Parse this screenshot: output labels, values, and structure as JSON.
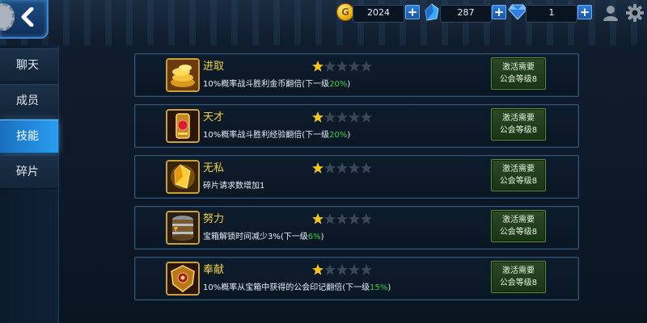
{
  "resources": {
    "gold": "2024",
    "crystal": "287",
    "diamond": "1",
    "plus_label": "+"
  },
  "sidebar": {
    "tabs": [
      {
        "label": "聊天"
      },
      {
        "label": "成员"
      },
      {
        "label": "技能"
      },
      {
        "label": "碎片"
      }
    ],
    "active_index": 2
  },
  "skills": [
    {
      "name": "进取",
      "desc_prefix": "10%概率战斗胜利金币翻倍(下一级",
      "desc_highlight": "20%",
      "desc_suffix": ")",
      "stars": 1,
      "max_stars": 5,
      "button_line1": "激活需要",
      "button_line2": "公会等级8",
      "icon": "gold-coins-icon"
    },
    {
      "name": "天才",
      "desc_prefix": "10%概率战斗胜利经验翻倍(下一级",
      "desc_highlight": "20%",
      "desc_suffix": ")",
      "stars": 1,
      "max_stars": 5,
      "button_line1": "激活需要",
      "button_line2": "公会等级8",
      "icon": "ruby-amulet-icon"
    },
    {
      "name": "无私",
      "desc_prefix": "碎片请求数增加1",
      "desc_highlight": "",
      "desc_suffix": "",
      "stars": 1,
      "max_stars": 5,
      "button_line1": "激活需要",
      "button_line2": "公会等级8",
      "icon": "golden-shard-icon"
    },
    {
      "name": "努力",
      "desc_prefix": "宝箱解锁时间减少3%(下一级",
      "desc_highlight": "6%",
      "desc_suffix": ")",
      "stars": 1,
      "max_stars": 5,
      "button_line1": "激活需要",
      "button_line2": "公会等级8",
      "icon": "barrel-icon"
    },
    {
      "name": "奉献",
      "desc_prefix": "10%概率从宝箱中获得的公会印记翻倍(下一级",
      "desc_highlight": "15%",
      "desc_suffix": ")",
      "stars": 1,
      "max_stars": 5,
      "button_line1": "激活需要",
      "button_line2": "公会等级8",
      "icon": "guild-emblem-icon"
    }
  ],
  "colors": {
    "accent": "#2a9ef0",
    "skill_name": "#f2d23a",
    "highlight": "#33d24a",
    "star_on": "#f5c518",
    "star_off": "#3a4656"
  }
}
